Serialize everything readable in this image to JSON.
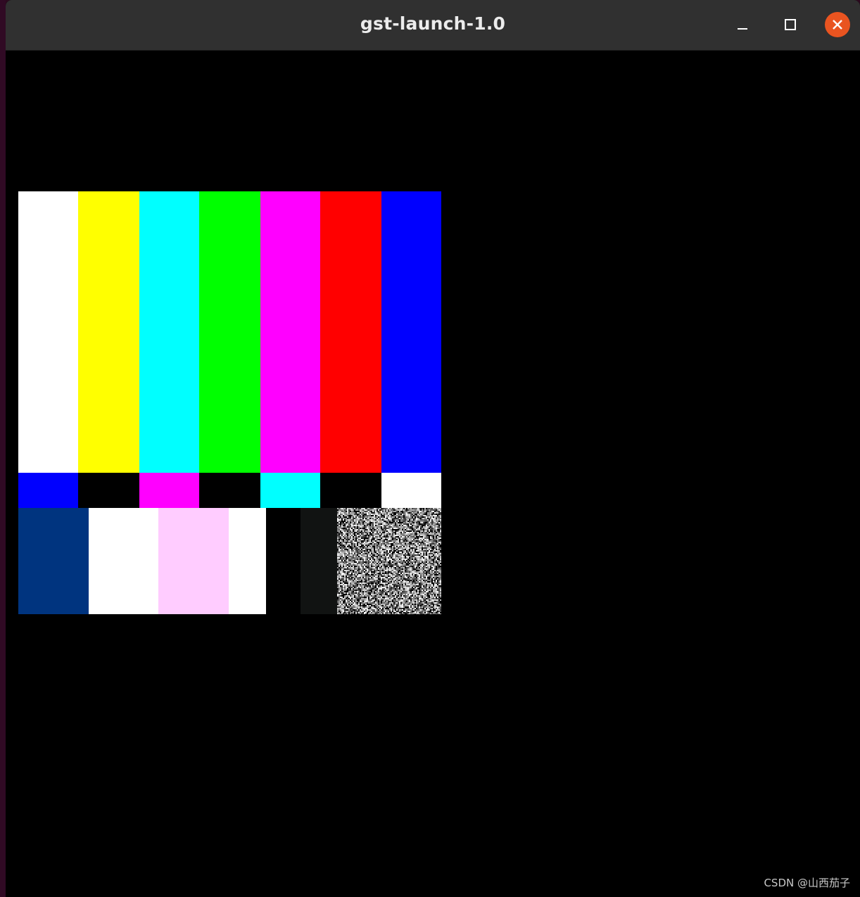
{
  "window": {
    "title": "gst-launch-1.0",
    "buttons": {
      "minimize_icon": "minimize-icon",
      "maximize_icon": "maximize-icon",
      "close_icon": "close-icon"
    }
  },
  "test_pattern": {
    "top_bars": [
      "#ffffff",
      "#ffff00",
      "#00ffff",
      "#00ff00",
      "#ff00ff",
      "#ff0000",
      "#0000ff"
    ],
    "middle_bars": [
      "#0000ff",
      "#000000",
      "#ff00ff",
      "#000000",
      "#00ffff",
      "#000000",
      "#ffffff"
    ],
    "bottom_blocks": [
      "#00347f",
      "#ffffff",
      "#ffccff",
      "#ffffff",
      "#000000",
      "#111312"
    ],
    "noise_block": "noise"
  },
  "watermark": "CSDN @山西茄子"
}
